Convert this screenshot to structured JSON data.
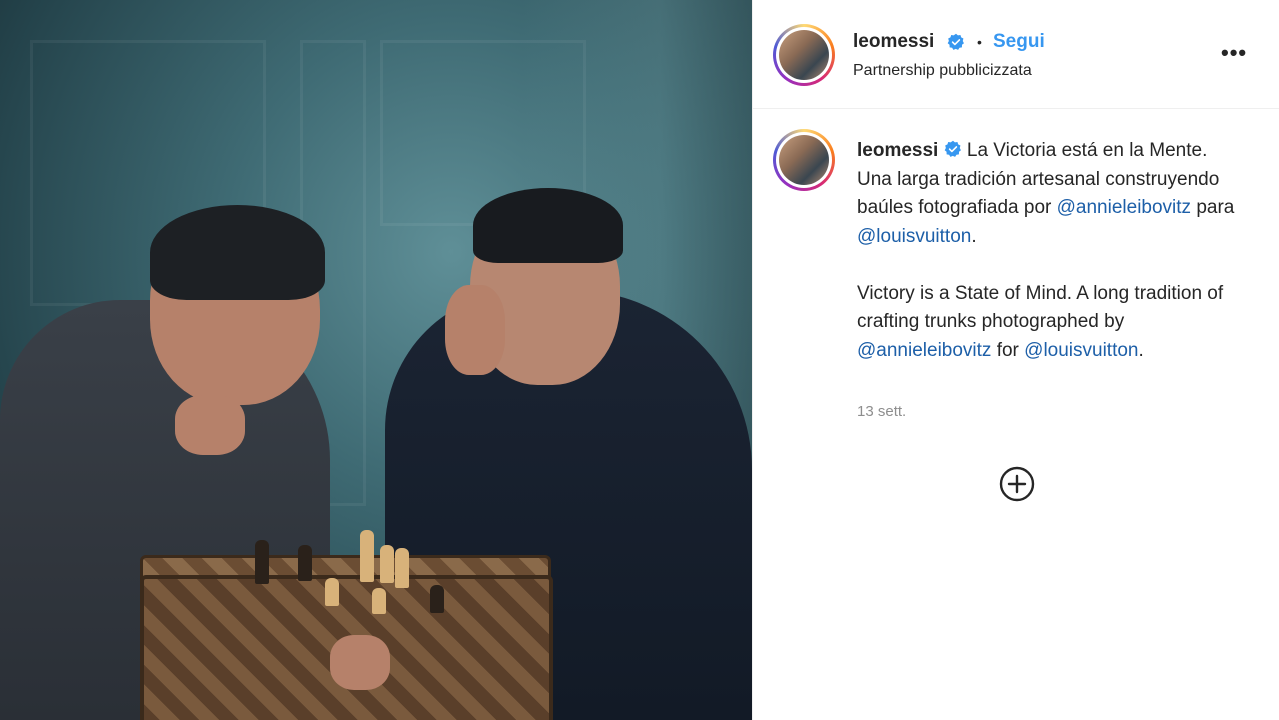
{
  "post": {
    "author": {
      "username": "leomessi",
      "verified": true,
      "follow_label": "Segui",
      "subtitle": "Partnership pubblicizzata",
      "more_icon": "more-options-icon"
    },
    "caption": {
      "username": "leomessi",
      "text_es_1": "La Victoria está en la Mente. Una larga tradición artesanal construyendo baúles fotografiada por ",
      "mention_1": "@annieleibovitz",
      "text_es_2": " para ",
      "mention_2": "@louisvuitton",
      "text_es_3": ".",
      "text_en_1": "Victory is a State of Mind. A long tradition of crafting trunks photographed by ",
      "mention_3": "@annieleibovitz",
      "text_en_2": " for ",
      "mention_4": "@louisvuitton",
      "text_en_3": "."
    },
    "timestamp": "13 sett.",
    "load_more_icon": "plus-circle-icon"
  },
  "colors": {
    "link": "#1d5fa8",
    "follow": "#3797f0",
    "verified": "#3797f0",
    "text": "#262626",
    "muted": "#8e8e8e"
  }
}
